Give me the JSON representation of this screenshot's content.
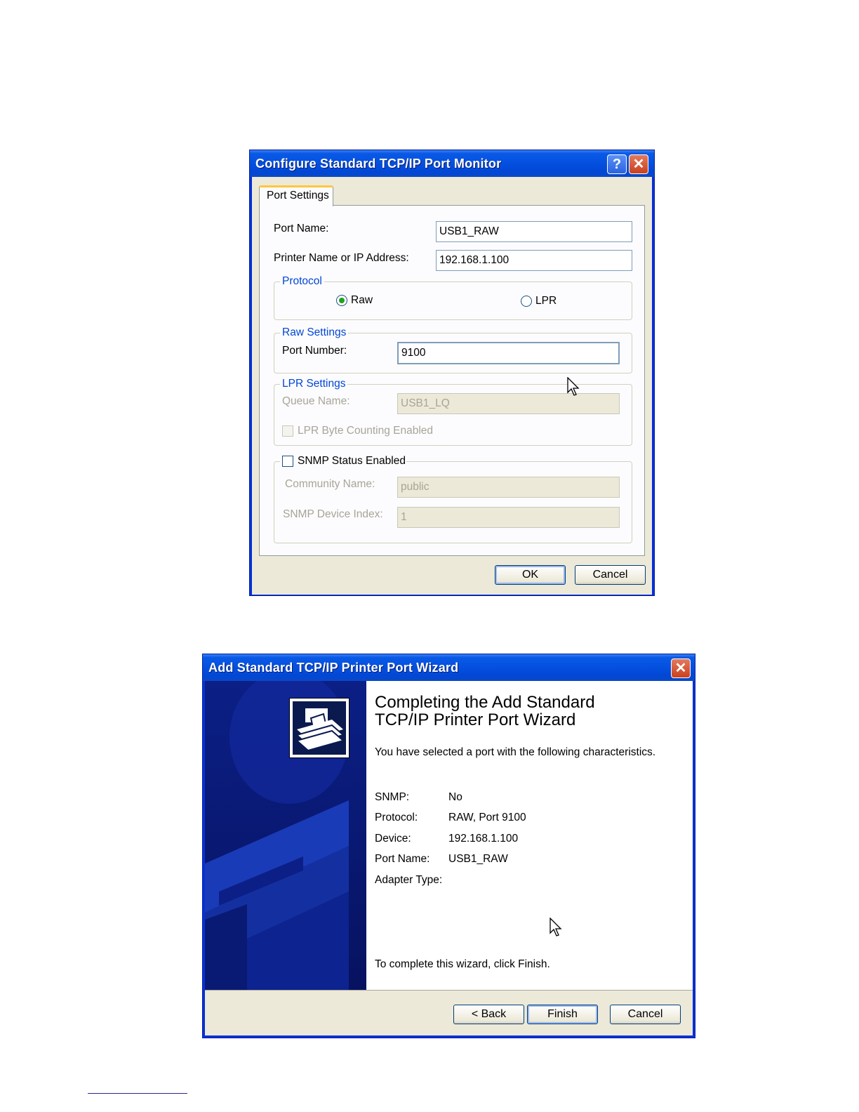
{
  "dialog1": {
    "title": "Configure Standard TCP/IP Port Monitor",
    "help_glyph": "?",
    "close_glyph": "✕",
    "tab": "Port Settings",
    "port_name_label": "Port Name:",
    "port_name_value": "USB1_RAW",
    "printer_label": "Printer Name or IP Address:",
    "printer_value": "192.168.1.100",
    "protocol": {
      "title": "Protocol",
      "raw_label": "Raw",
      "lpr_label": "LPR",
      "selected": "Raw"
    },
    "raw_settings": {
      "title": "Raw Settings",
      "port_number_label": "Port Number:",
      "port_number_value": "9100"
    },
    "lpr_settings": {
      "title": "LPR Settings",
      "queue_label": "Queue Name:",
      "queue_value": "USB1_LQ",
      "byte_counting_label": "LPR Byte Counting Enabled"
    },
    "snmp": {
      "enabled_label": "SNMP Status Enabled",
      "community_label": "Community Name:",
      "community_value": "public",
      "index_label": "SNMP Device Index:",
      "index_value": "1"
    },
    "ok_label": "OK",
    "cancel_label": "Cancel"
  },
  "dialog2": {
    "title": "Add Standard TCP/IP Printer Port Wizard",
    "close_glyph": "✕",
    "heading_line1": "Completing the Add Standard",
    "heading_line2": "TCP/IP Printer Port Wizard",
    "intro": "You have selected a port with the following characteristics.",
    "details": [
      {
        "label": "SNMP:",
        "value": "No"
      },
      {
        "label": "Protocol:",
        "value": "RAW, Port 9100"
      },
      {
        "label": "Device:",
        "value": "192.168.1.100"
      },
      {
        "label": "Port Name:",
        "value": "USB1_RAW"
      },
      {
        "label": "Adapter Type:",
        "value": ""
      }
    ],
    "footer_text": "To complete this wizard, click Finish.",
    "back_label": "< Back",
    "finish_label": "Finish",
    "cancel_label": "Cancel"
  },
  "icons": [
    "help-icon",
    "close-icon",
    "printer-wizard-icon",
    "mouse-cursor-icon"
  ]
}
